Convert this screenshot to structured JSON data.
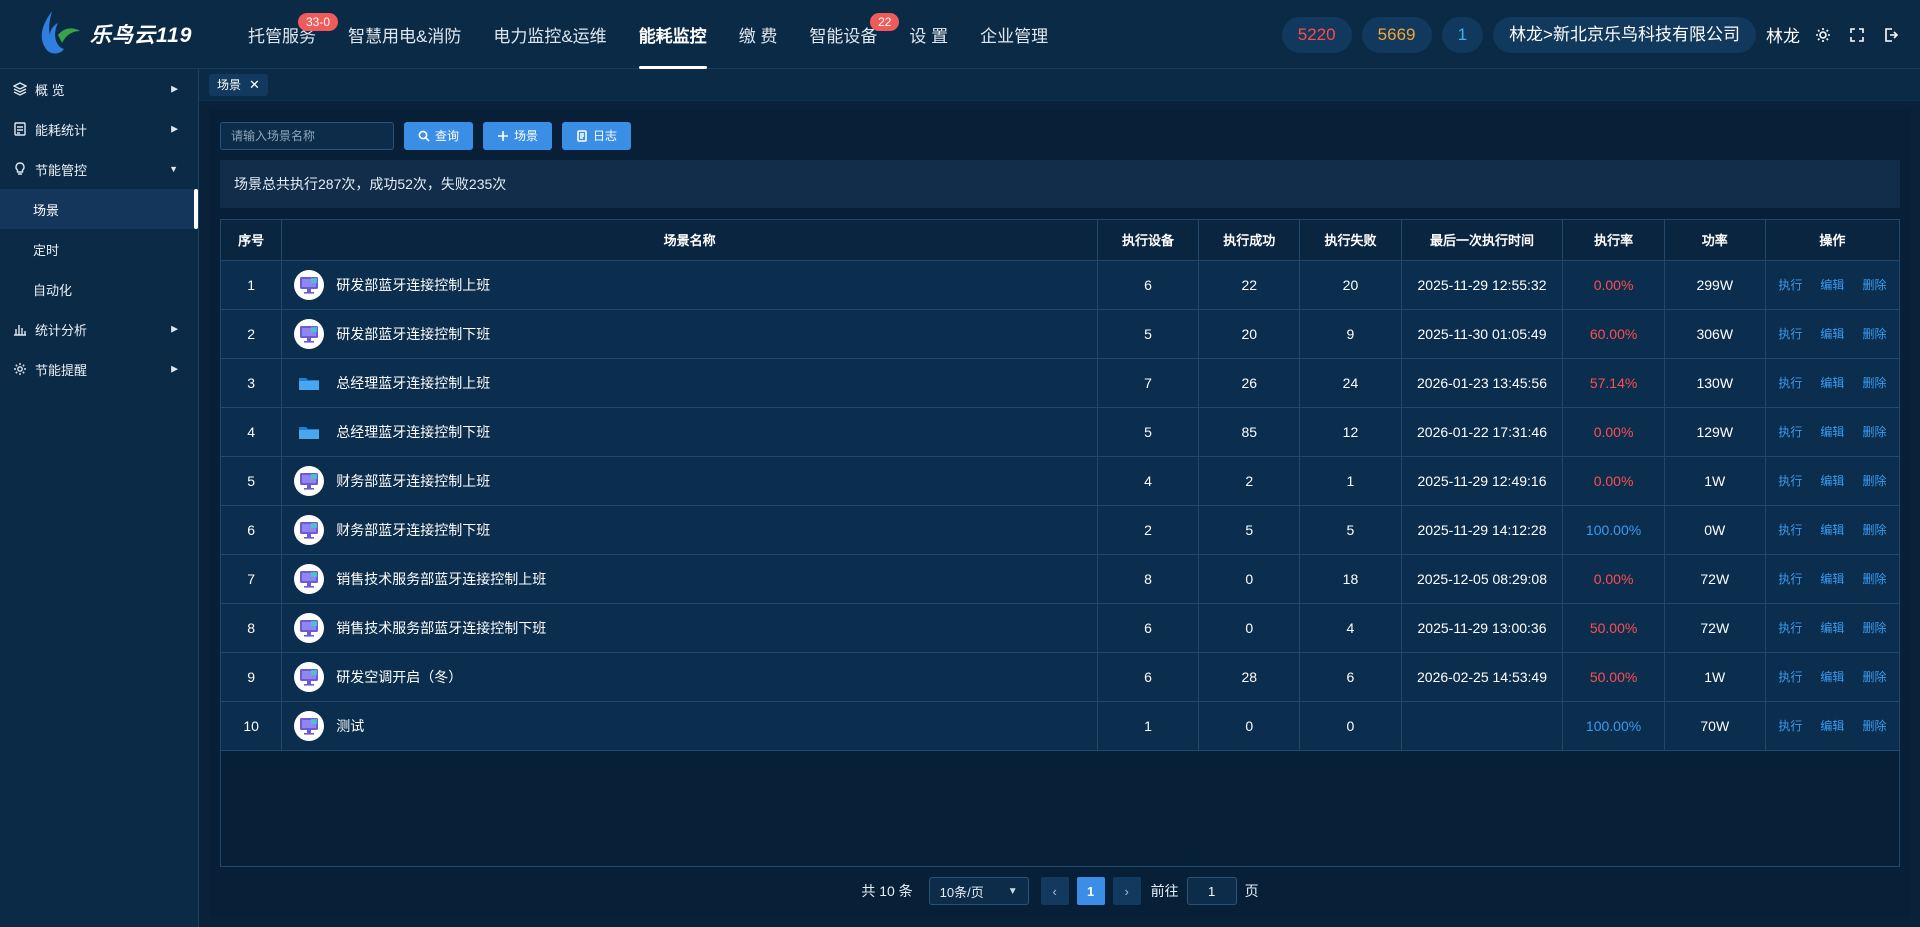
{
  "app": {
    "logo_text": "乐鸟云119"
  },
  "topnav": [
    {
      "label": "托管服务",
      "badge": "33-0"
    },
    {
      "label": "智慧用电&消防",
      "badge": ""
    },
    {
      "label": "电力监控&运维",
      "badge": ""
    },
    {
      "label": "能耗监控",
      "badge": "",
      "active": true
    },
    {
      "label": "缴 费",
      "badge": ""
    },
    {
      "label": "智能设备",
      "badge": "22"
    },
    {
      "label": "设 置",
      "badge": ""
    },
    {
      "label": "企业管理",
      "badge": ""
    }
  ],
  "header_right": {
    "count_red": "5220",
    "count_orange": "5669",
    "count_cyan": "1",
    "company": "林龙>新北京乐鸟科技有限公司",
    "username": "林龙",
    "icons": [
      "brightness-icon",
      "fullscreen-icon",
      "logout-icon"
    ]
  },
  "sidebar": {
    "items": [
      {
        "label": "概 览",
        "icon": "layers-icon",
        "has_caret": true,
        "caret": "▶"
      },
      {
        "label": "能耗统计",
        "icon": "report-icon",
        "has_caret": true,
        "caret": "▶"
      },
      {
        "label": "节能管控",
        "icon": "bulb-icon",
        "has_caret": true,
        "caret": "▼"
      },
      {
        "label": "场景",
        "sub": true,
        "active": true
      },
      {
        "label": "定时",
        "sub": true
      },
      {
        "label": "自动化",
        "sub": true
      },
      {
        "label": "统计分析",
        "icon": "bar-chart-icon",
        "has_caret": true,
        "caret": "▶"
      },
      {
        "label": "节能提醒",
        "icon": "alert-gear-icon",
        "has_caret": true,
        "caret": "▶"
      }
    ]
  },
  "tagbar": {
    "tag_label": "场景",
    "close": "✕"
  },
  "toolbar": {
    "search_placeholder": "请输入场景名称",
    "query_label": "查询",
    "add_label": "场景",
    "log_label": "日志"
  },
  "summary_text": "场景总共执行287次，成功52次，失败235次",
  "table": {
    "headers": [
      "序号",
      "场景名称",
      "执行设备",
      "执行成功",
      "执行失败",
      "最后一次执行时间",
      "执行率",
      "功率",
      "操作"
    ],
    "op_labels": [
      "执行",
      "编辑",
      "删除"
    ],
    "rows": [
      {
        "no": "1",
        "icon": "monitor",
        "name": "研发部蓝牙连接控制上班",
        "devices": "6",
        "success": "22",
        "fail": "20",
        "last_time": "2025-11-29 12:55:32",
        "rate": "0.00%",
        "rate_color": "red",
        "power": "299W"
      },
      {
        "no": "2",
        "icon": "monitor",
        "name": "研发部蓝牙连接控制下班",
        "devices": "5",
        "success": "20",
        "fail": "9",
        "last_time": "2025-11-30 01:05:49",
        "rate": "60.00%",
        "rate_color": "red",
        "power": "306W"
      },
      {
        "no": "3",
        "icon": "folder",
        "name": "总经理蓝牙连接控制上班",
        "devices": "7",
        "success": "26",
        "fail": "24",
        "last_time": "2026-01-23 13:45:56",
        "rate": "57.14%",
        "rate_color": "red",
        "power": "130W"
      },
      {
        "no": "4",
        "icon": "folder",
        "name": "总经理蓝牙连接控制下班",
        "devices": "5",
        "success": "85",
        "fail": "12",
        "last_time": "2026-01-22 17:31:46",
        "rate": "0.00%",
        "rate_color": "red",
        "power": "129W"
      },
      {
        "no": "5",
        "icon": "monitor",
        "name": "财务部蓝牙连接控制上班",
        "devices": "4",
        "success": "2",
        "fail": "1",
        "last_time": "2025-11-29 12:49:16",
        "rate": "0.00%",
        "rate_color": "red",
        "power": "1W"
      },
      {
        "no": "6",
        "icon": "monitor",
        "name": "财务部蓝牙连接控制下班",
        "devices": "2",
        "success": "5",
        "fail": "5",
        "last_time": "2025-11-29 14:12:28",
        "rate": "100.00%",
        "rate_color": "blue",
        "power": "0W"
      },
      {
        "no": "7",
        "icon": "monitor",
        "name": "销售技术服务部蓝牙连接控制上班",
        "devices": "8",
        "success": "0",
        "fail": "18",
        "last_time": "2025-12-05 08:29:08",
        "rate": "0.00%",
        "rate_color": "red",
        "power": "72W"
      },
      {
        "no": "8",
        "icon": "monitor",
        "name": "销售技术服务部蓝牙连接控制下班",
        "devices": "6",
        "success": "0",
        "fail": "4",
        "last_time": "2025-11-29 13:00:36",
        "rate": "50.00%",
        "rate_color": "red",
        "power": "72W"
      },
      {
        "no": "9",
        "icon": "monitor",
        "name": "研发空调开启（冬）",
        "devices": "6",
        "success": "28",
        "fail": "6",
        "last_time": "2026-02-25 14:53:49",
        "rate": "50.00%",
        "rate_color": "red",
        "power": "1W"
      },
      {
        "no": "10",
        "icon": "monitor",
        "name": "测试",
        "devices": "1",
        "success": "0",
        "fail": "0",
        "last_time": "",
        "rate": "100.00%",
        "rate_color": "blue",
        "power": "70W"
      }
    ]
  },
  "pagination": {
    "total": "共 10 条",
    "page_size": "10条/页",
    "prev": "‹",
    "current_page": "1",
    "next": "›",
    "goto_label": "前往",
    "goto_value": "1",
    "page_unit": "页"
  },
  "colors": {
    "accent": "#3a8ee6",
    "danger": "#ff4d4f",
    "link": "#3a9bf0",
    "badge": "#ef5b5b"
  }
}
